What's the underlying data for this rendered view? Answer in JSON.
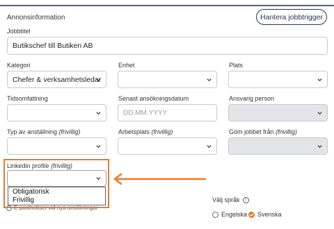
{
  "section": {
    "title": "Annonsinformation",
    "manage_button": "Hantera jobbtrigger"
  },
  "fields": {
    "jobbtitel": {
      "label": "Jobbtitel",
      "value": "Butikschef till Butiken AB"
    },
    "kategori": {
      "label": "Kategori",
      "value": "Chefer & verksamhetsledar"
    },
    "enhet": {
      "label": "Enhet",
      "value": ""
    },
    "plats": {
      "label": "Plats",
      "value": ""
    },
    "tidsomfattning": {
      "label": "Tidsomfattning",
      "value": ""
    },
    "senast": {
      "label": "Senast ansökningsdatum",
      "placeholder": "DD.MM.YYYY"
    },
    "ansvarig": {
      "label": "Ansvarig person",
      "value": ""
    },
    "anstallning": {
      "label": "Typ av anställning",
      "optional": "(frivillig)"
    },
    "arbetsplats": {
      "label": "Arbetsplats",
      "optional": "(frivillig)"
    },
    "gom": {
      "label": "Göm jobbet från",
      "optional": "(frivillig)"
    },
    "linkedin": {
      "label": "Linkedin profile",
      "optional": "(frivillig)"
    }
  },
  "linkedin_options": [
    "Obligatorisk",
    "Frivillig"
  ],
  "behind": {
    "email_text": "E-postnotiser vid nya ansökningar"
  },
  "language": {
    "label": "Välj språk",
    "info_icon": "i",
    "options": [
      {
        "label": "Engelska",
        "checked": false
      },
      {
        "label": "Svenska",
        "checked": true
      }
    ]
  },
  "colors": {
    "accent": "#e8792f",
    "button_border": "#2b3352",
    "disabled_field": "#e3e5e8"
  }
}
